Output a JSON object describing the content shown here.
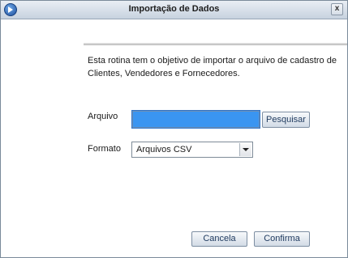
{
  "window": {
    "title": "Importação de Dados",
    "close_label": "x"
  },
  "description": "Esta rotina tem o objetivo de importar o arquivo de cadastro de Clientes, Vendedores e Fornecedores.",
  "form": {
    "file_label": "Arquivo",
    "file_value": "",
    "search_button": "Pesquisar",
    "format_label": "Formato",
    "format_value": "Arquivos CSV"
  },
  "buttons": {
    "cancel": "Cancela",
    "confirm": "Confirma"
  },
  "colors": {
    "input_highlight": "#3a95f1",
    "titlebar": "#d4dde8"
  }
}
